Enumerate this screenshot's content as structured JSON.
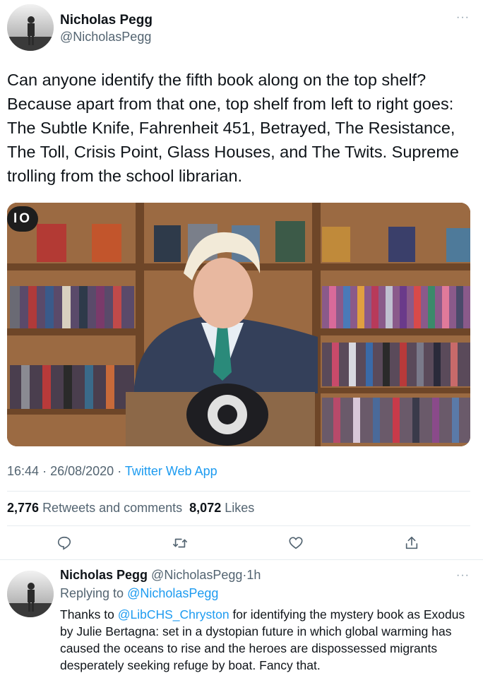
{
  "tweet": {
    "author_name": "Nicholas Pegg",
    "author_handle": "@NicholasPegg",
    "more_label": "···",
    "text": "Can anyone identify the fifth book along on the top shelf? Because apart from that one, top shelf from left to right goes: The Subtle Knife, Fahrenheit 451, Betrayed, The Resistance, The Toll, Crisis Point, Glass Houses, and The Twits. Supreme trolling from the school librarian.",
    "video_badge": "IO",
    "time": "16:44",
    "date": "26/08/2020",
    "source": "Twitter Web App",
    "meta_separator": "·",
    "retweets_count": "2,776",
    "retweets_label": "Retweets and comments",
    "likes_count": "8,072",
    "likes_label": "Likes"
  },
  "actions": [
    {
      "icon": "reply-icon"
    },
    {
      "icon": "retweet-icon"
    },
    {
      "icon": "like-icon"
    },
    {
      "icon": "share-icon"
    }
  ],
  "reply": {
    "author_name": "Nicholas Pegg",
    "author_handle": "@NicholasPegg",
    "age": "1h",
    "separator": "·",
    "more_label": "···",
    "replying_to_label": "Replying to",
    "replying_to_handle": "@NicholasPegg",
    "text_before": "Thanks to",
    "mention": "@LibCHS_Chryston",
    "text_after": "for identifying the mystery book as Exodus by Julie Bertagna: set in a dystopian future in which global warming has caused the oceans to rise and the heroes are dispossessed migrants desperately seeking refuge by boat. Fancy that."
  },
  "colors": {
    "link": "#1d9bf0",
    "secondary_text": "#536471",
    "divider": "#e6ecf0"
  }
}
